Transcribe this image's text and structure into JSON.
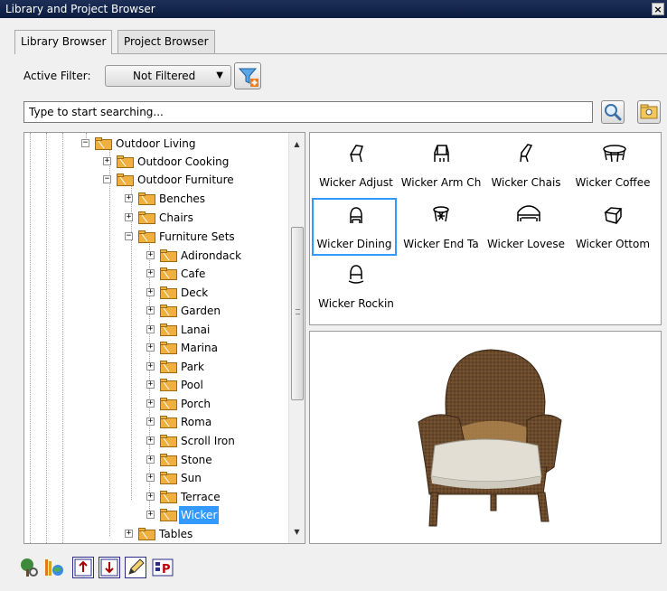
{
  "window": {
    "title": "Library and Project Browser",
    "close": "×"
  },
  "tabs": [
    {
      "label": "Library Browser",
      "active": true
    },
    {
      "label": "Project Browser",
      "active": false
    }
  ],
  "filter": {
    "label": "Active Filter:",
    "value": "Not Filtered"
  },
  "search": {
    "placeholder": "Type to start searching..."
  },
  "tree": [
    {
      "label": "Outdoor Living",
      "expanded": true
    },
    {
      "label": "Outdoor Cooking",
      "expanded": false
    },
    {
      "label": "Outdoor Furniture",
      "expanded": true
    },
    {
      "label": "Benches",
      "expanded": false
    },
    {
      "label": "Chairs",
      "expanded": false
    },
    {
      "label": "Furniture Sets",
      "expanded": true
    },
    {
      "label": "Adirondack",
      "expanded": false
    },
    {
      "label": "Cafe",
      "expanded": false
    },
    {
      "label": "Deck",
      "expanded": false
    },
    {
      "label": "Garden",
      "expanded": false
    },
    {
      "label": "Lanai",
      "expanded": false
    },
    {
      "label": "Marina",
      "expanded": false
    },
    {
      "label": "Park",
      "expanded": false
    },
    {
      "label": "Pool",
      "expanded": false
    },
    {
      "label": "Porch",
      "expanded": false
    },
    {
      "label": "Roma",
      "expanded": false
    },
    {
      "label": "Scroll Iron",
      "expanded": false
    },
    {
      "label": "Stone",
      "expanded": false
    },
    {
      "label": "Sun",
      "expanded": false
    },
    {
      "label": "Terrace",
      "expanded": false
    },
    {
      "label": "Wicker",
      "expanded": false,
      "selected": true
    },
    {
      "label": "Tables",
      "expanded": false
    }
  ],
  "items": [
    {
      "label": "Wicker Adjust",
      "icon": "adjustable-chair-icon"
    },
    {
      "label": "Wicker Arm Ch",
      "icon": "arm-chair-icon"
    },
    {
      "label": "Wicker Chais",
      "icon": "chaise-icon"
    },
    {
      "label": "Wicker Coffee",
      "icon": "coffee-table-icon"
    },
    {
      "label": "Wicker Dining",
      "icon": "dining-chair-icon",
      "selected": true
    },
    {
      "label": "Wicker End Ta",
      "icon": "end-table-icon"
    },
    {
      "label": "Wicker Lovese",
      "icon": "loveseat-icon"
    },
    {
      "label": "Wicker Ottom",
      "icon": "ottoman-icon"
    },
    {
      "label": "Wicker Rockin",
      "icon": "rocking-chair-icon"
    }
  ],
  "preview": {
    "subject": "wicker-dining-chair-3d-preview"
  },
  "colors": {
    "accent": "#3399ff",
    "folder": "#f0b040",
    "wicker": "#6b4a2c",
    "cushion": "#e2ded3"
  }
}
